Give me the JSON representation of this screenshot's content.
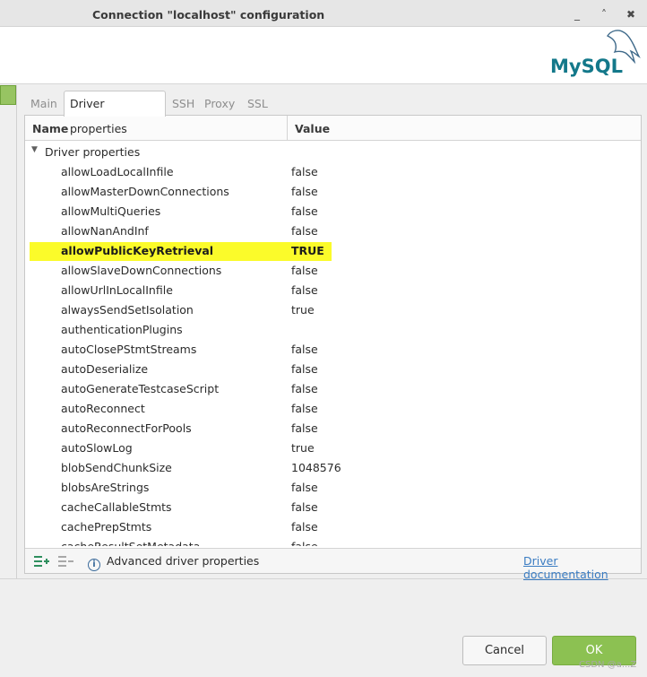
{
  "window": {
    "title": "Connection \"localhost\" configuration",
    "controls": [
      "_",
      "˄",
      "✖"
    ]
  },
  "logo": {
    "text": "MySQL",
    "icon": "mysql-dolphin-logo"
  },
  "tabs": [
    {
      "label": "Main",
      "active": false
    },
    {
      "label": "Driver properties",
      "active": true
    },
    {
      "label": "SSH",
      "active": false
    },
    {
      "label": "Proxy",
      "active": false
    },
    {
      "label": "SSL",
      "active": false
    }
  ],
  "grid": {
    "columns": {
      "name": "Name",
      "value": "Value"
    },
    "group": "Driver properties",
    "rows": [
      {
        "name": "allowLoadLocalInfile",
        "value": "false"
      },
      {
        "name": "allowMasterDownConnections",
        "value": "false"
      },
      {
        "name": "allowMultiQueries",
        "value": "false"
      },
      {
        "name": "allowNanAndInf",
        "value": "false"
      },
      {
        "name": "allowPublicKeyRetrieval",
        "value": "TRUE",
        "highlighted": true
      },
      {
        "name": "allowSlaveDownConnections",
        "value": "false"
      },
      {
        "name": "allowUrlInLocalInfile",
        "value": "false"
      },
      {
        "name": "alwaysSendSetIsolation",
        "value": "true"
      },
      {
        "name": "authenticationPlugins",
        "value": ""
      },
      {
        "name": "autoClosePStmtStreams",
        "value": "false"
      },
      {
        "name": "autoDeserialize",
        "value": "false"
      },
      {
        "name": "autoGenerateTestcaseScript",
        "value": "false"
      },
      {
        "name": "autoReconnect",
        "value": "false"
      },
      {
        "name": "autoReconnectForPools",
        "value": "false"
      },
      {
        "name": "autoSlowLog",
        "value": "true"
      },
      {
        "name": "blobSendChunkSize",
        "value": "1048576"
      },
      {
        "name": "blobsAreStrings",
        "value": "false"
      },
      {
        "name": "cacheCallableStmts",
        "value": "false"
      },
      {
        "name": "cachePrepStmts",
        "value": "false"
      },
      {
        "name": "cacheResultSetMetadata",
        "value": "false"
      }
    ]
  },
  "footer": {
    "add_icon": "add-property-icon",
    "remove_icon": "remove-property-icon",
    "advanced_label": "Advanced driver properties",
    "doc_link": "Driver documentation"
  },
  "buttons": {
    "cancel": "Cancel",
    "ok": "OK"
  },
  "watermark": "CSDN @a...Z",
  "colors": {
    "highlight": "#fbfb2a",
    "ok_button": "#8cc152",
    "link": "#3a7cc2"
  }
}
